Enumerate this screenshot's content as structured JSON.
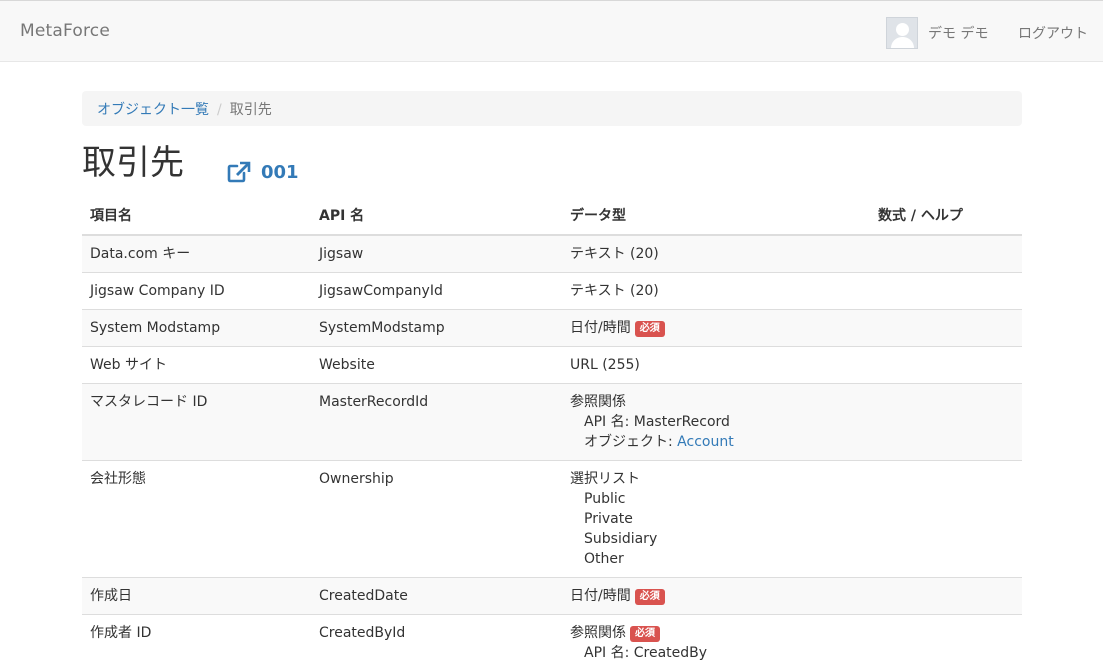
{
  "navbar": {
    "brand": "MetaForce",
    "user_name": "デモ デモ",
    "logout_label": "ログアウト"
  },
  "breadcrumb": {
    "parent": "オブジェクト一覧",
    "separator": "/",
    "current": "取引先"
  },
  "page": {
    "title": "取引先",
    "key_prefix": "001"
  },
  "table": {
    "headers": [
      "項目名",
      "API 名",
      "データ型",
      "数式 / ヘルプ"
    ],
    "rows": [
      {
        "label": "Data.com キー",
        "api": "Jigsaw",
        "type": "テキスト (20)"
      },
      {
        "label": "Jigsaw Company ID",
        "api": "JigsawCompanyId",
        "type": "テキスト (20)"
      },
      {
        "label": "System Modstamp",
        "api": "SystemModstamp",
        "type": "日付/時間",
        "badge": "必須"
      },
      {
        "label": "Web サイト",
        "api": "Website",
        "type": "URL (255)"
      },
      {
        "label": "マスタレコード ID",
        "api": "MasterRecordId",
        "type": "参照関係",
        "api_name_line": "API 名: MasterRecord",
        "object_prefix": "オブジェクト: ",
        "object_link": "Account"
      },
      {
        "label": "会社形態",
        "api": "Ownership",
        "type": "選択リスト",
        "options": [
          "Public",
          "Private",
          "Subsidiary",
          "Other"
        ]
      },
      {
        "label": "作成日",
        "api": "CreatedDate",
        "type": "日付/時間",
        "badge": "必須"
      },
      {
        "label": "作成者 ID",
        "api": "CreatedById",
        "type": "参照関係",
        "badge": "必須",
        "api_name_line": "API 名: CreatedBy"
      }
    ]
  },
  "colors": {
    "link": "#337ab7",
    "badge": "#d9534f",
    "navbar_bg": "#f8f8f8"
  },
  "icons": {
    "external_link": "external-link-icon",
    "avatar": "user-avatar-icon"
  }
}
